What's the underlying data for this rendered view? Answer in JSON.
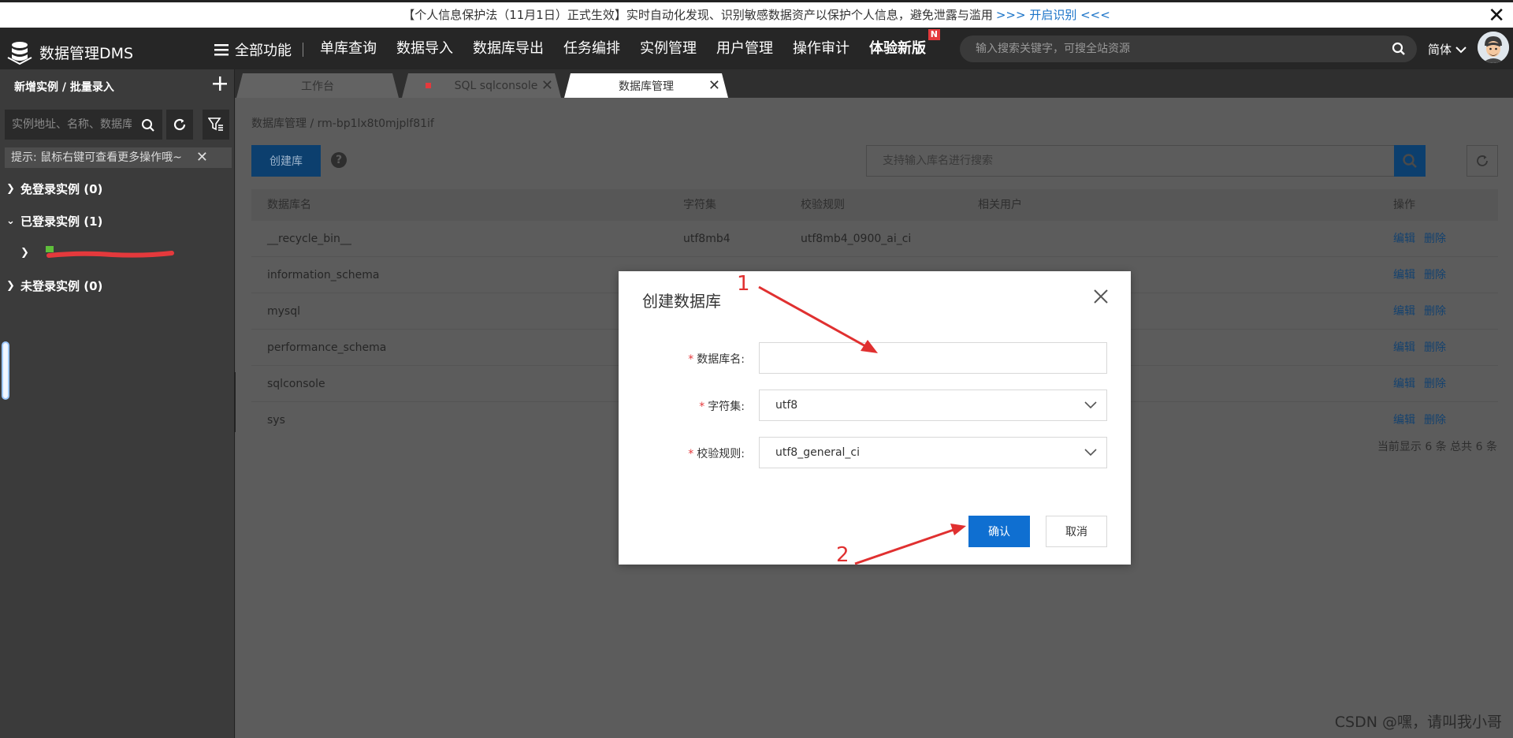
{
  "notice": {
    "text": "【个人信息保护法（11月1日）正式生效】实时自动化发现、识别敏感数据资产以保护个人信息，避免泄露与滥用",
    "link": ">>> 开启识别 <<<",
    "close": "✕"
  },
  "topnav": {
    "logo": "数据管理DMS",
    "all_features": "全部功能",
    "items": [
      "单库查询",
      "数据导入",
      "数据库导出",
      "任务编排",
      "实例管理",
      "用户管理",
      "操作审计"
    ],
    "new_version": "体验新版",
    "new_badge": "N",
    "search_placeholder": "输入搜索关键字，可搜全站资源",
    "lang": "简体"
  },
  "sidebar": {
    "header": "新增实例 / 批量录入",
    "search_placeholder": "实例地址、名称、数据库",
    "tip": "提示: 鼠标右键可查看更多操作哦~",
    "tree": [
      {
        "label": "免登录实例  (0)",
        "arrow": "›"
      },
      {
        "label": "已登录实例  (1)",
        "arrow": "⌄"
      },
      {
        "label": "未登录实例  (0)",
        "arrow": "›"
      }
    ]
  },
  "tabs": [
    {
      "label": "工作台"
    },
    {
      "label": "SQL sqlconsole"
    },
    {
      "label": "数据库管理"
    }
  ],
  "main": {
    "breadcrumb": "数据库管理 / rm-bp1lx8t0mjplf81if",
    "create_btn": "创建库",
    "help": "?",
    "search_placeholder": "支持输入库名进行搜索",
    "columns": [
      "数据库名",
      "字符集",
      "校验规则",
      "相关用户",
      "操作"
    ],
    "rows": [
      {
        "name": "__recycle_bin__",
        "charset": "utf8mb4",
        "collation": "utf8mb4_0900_ai_ci",
        "users": ""
      },
      {
        "name": "information_schema",
        "charset": "",
        "collation": "",
        "users": ""
      },
      {
        "name": "mysql",
        "charset": "",
        "collation": "",
        "users": ""
      },
      {
        "name": "performance_schema",
        "charset": "",
        "collation": "",
        "users": ""
      },
      {
        "name": "sqlconsole",
        "charset": "",
        "collation": "",
        "users": ""
      },
      {
        "name": "sys",
        "charset": "",
        "collation": "",
        "users": ""
      }
    ],
    "edit": "编辑",
    "delete": "删除",
    "summary": "当前显示 6 条 总共 6 条"
  },
  "modal": {
    "title": "创建数据库",
    "db_name_label": "数据库名:",
    "db_name_value": "",
    "charset_label": "字符集:",
    "charset_value": "utf8",
    "collation_label": "校验规则:",
    "collation_value": "utf8_general_ci",
    "confirm": "确认",
    "cancel": "取消"
  },
  "annotations": {
    "one": "1",
    "two": "2"
  },
  "watermark": "CSDN @嘿，请叫我小哥",
  "colors": {
    "primary": "#0f6fd1",
    "annotation": "#e03030",
    "nav_bg": "#262626"
  }
}
